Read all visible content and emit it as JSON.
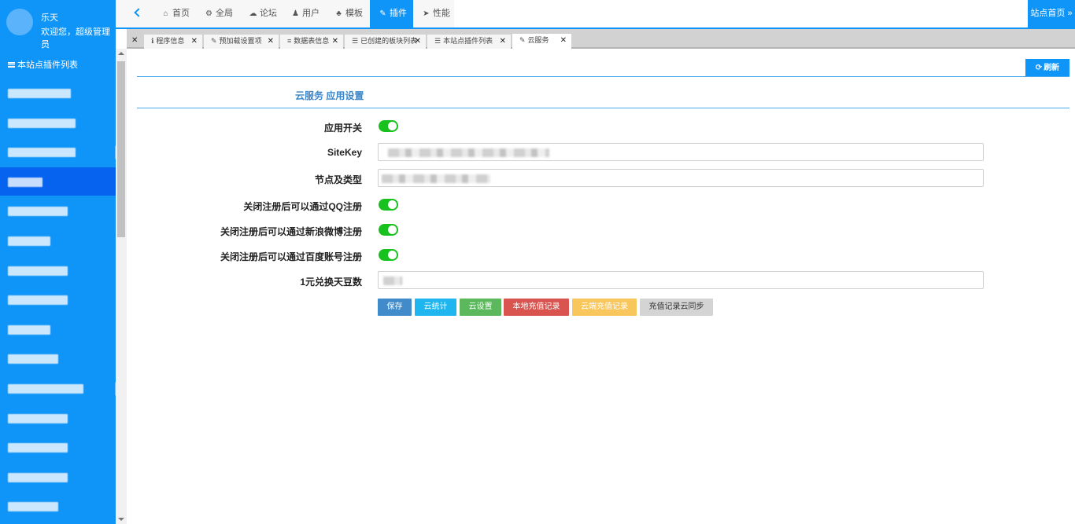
{
  "user": {
    "name": "乐天",
    "welcome": "欢迎您，超级管理员"
  },
  "sidebar": {
    "title": "本站点插件列表",
    "items": [
      {
        "blur_w": 80,
        "active": false,
        "arrow": false
      },
      {
        "blur_w": 86,
        "active": false,
        "arrow": false
      },
      {
        "blur_w": 86,
        "active": false,
        "arrow": true
      },
      {
        "blur_w": 44,
        "active": true,
        "arrow": false
      },
      {
        "blur_w": 76,
        "active": false,
        "arrow": false
      },
      {
        "blur_w": 54,
        "active": false,
        "arrow": false
      },
      {
        "blur_w": 76,
        "active": false,
        "arrow": false
      },
      {
        "blur_w": 76,
        "active": false,
        "arrow": false
      },
      {
        "blur_w": 54,
        "active": false,
        "arrow": false
      },
      {
        "blur_w": 64,
        "active": false,
        "arrow": false
      },
      {
        "blur_w": 96,
        "active": false,
        "arrow": true
      },
      {
        "blur_w": 76,
        "active": false,
        "arrow": false
      },
      {
        "blur_w": 76,
        "active": false,
        "arrow": false
      },
      {
        "blur_w": 76,
        "active": false,
        "arrow": false
      },
      {
        "blur_w": 64,
        "active": false,
        "arrow": false
      }
    ]
  },
  "nav": {
    "tabs": [
      {
        "label": "首页",
        "icon": "home-icon",
        "glyph": "⌂",
        "active": false
      },
      {
        "label": "全局",
        "icon": "cogs-icon",
        "glyph": "⚙",
        "active": false
      },
      {
        "label": "论坛",
        "icon": "comments-icon",
        "glyph": "☁",
        "active": false
      },
      {
        "label": "用户",
        "icon": "users-icon",
        "glyph": "♟",
        "active": false
      },
      {
        "label": "模板",
        "icon": "sitemap-icon",
        "glyph": "♣",
        "active": false
      },
      {
        "label": "插件",
        "icon": "plug-icon",
        "glyph": "✎",
        "active": true
      },
      {
        "label": "性能",
        "icon": "paper-plane-icon",
        "glyph": "➤",
        "active": false
      }
    ],
    "site_home": "站点首页 »"
  },
  "page_tabs": [
    {
      "label": "程序信息",
      "icon": "info-icon",
      "glyph": "ℹ",
      "active": false
    },
    {
      "label": "预加载设置项",
      "icon": "wrench-icon",
      "glyph": "✎",
      "active": false
    },
    {
      "label": "数据表信息",
      "icon": "database-icon",
      "glyph": "≡",
      "active": false
    },
    {
      "label": "已创建的板块列表",
      "icon": "list-icon",
      "glyph": "☰",
      "active": false
    },
    {
      "label": "本站点插件列表",
      "icon": "list-icon",
      "glyph": "☰",
      "active": false
    },
    {
      "label": "云服务",
      "icon": "plug-icon",
      "glyph": "✎",
      "active": true
    }
  ],
  "toolbar": {
    "refresh_label": "刷新"
  },
  "form": {
    "title": "云服务 应用设置",
    "app_switch_label": "应用开关",
    "sitekey_label": "SiteKey",
    "node_label": "节点及类型",
    "qq_label": "关闭注册后可以通过QQ注册",
    "weibo_label": "关闭注册后可以通过新浪微博注册",
    "baidu_label": "关闭注册后可以通过百度账号注册",
    "rate_label": "1元兑换天豆数",
    "app_switch_on": true,
    "qq_on": true,
    "weibo_on": true,
    "baidu_on": true
  },
  "actions": {
    "save": "保存",
    "stats": "云统计",
    "settings": "云设置",
    "local_records": "本地充值记录",
    "cloud_records": "云端充值记录",
    "sync": "充值记录云同步"
  },
  "colors": {
    "primary": "#0f94f7",
    "active_sidebar": "#0563ef",
    "toggle_on": "#19c11f",
    "save": "#428bca",
    "stats": "#1fb5ee",
    "settings": "#5cb85c",
    "local_records": "#d9534f",
    "cloud_records": "#f8c65a",
    "sync": "#d4d4d4"
  }
}
